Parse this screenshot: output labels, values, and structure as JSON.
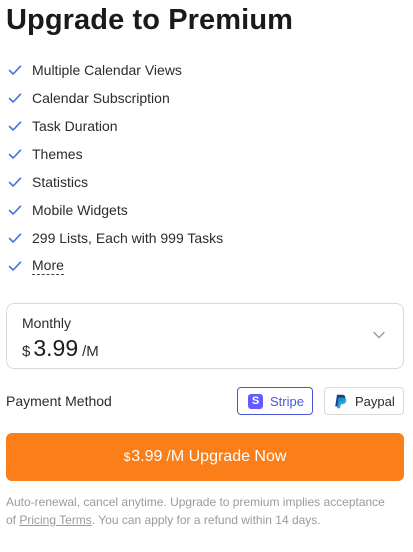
{
  "title": "Upgrade to Premium",
  "features": [
    "Multiple Calendar Views",
    "Calendar Subscription",
    "Task Duration",
    "Themes",
    "Statistics",
    "Mobile Widgets",
    "299 Lists, Each with 999 Tasks"
  ],
  "more_label": "More",
  "plan": {
    "name": "Monthly",
    "currency": "$",
    "amount": "3.99",
    "period": "/M"
  },
  "payment": {
    "label": "Payment Method",
    "options": [
      {
        "name": "Stripe",
        "selected": true
      },
      {
        "name": "Paypal",
        "selected": false
      }
    ]
  },
  "upgrade": {
    "currency": "$",
    "amount": "3.99",
    "rest": "/M Upgrade Now"
  },
  "terms": {
    "part1": "Auto-renewal, cancel anytime. Upgrade to premium implies acceptance of ",
    "link": "Pricing Terms",
    "part2": ". You can apply for a refund within 14 days."
  },
  "colors": {
    "accent": "#fb7e19",
    "check": "#4a6fd8",
    "stripe": "#4b56d6"
  },
  "icons": {
    "feature": "check-icon",
    "plan_select": "chevron-down-icon",
    "stripe": "stripe-logo-icon",
    "paypal": "paypal-logo-icon"
  }
}
